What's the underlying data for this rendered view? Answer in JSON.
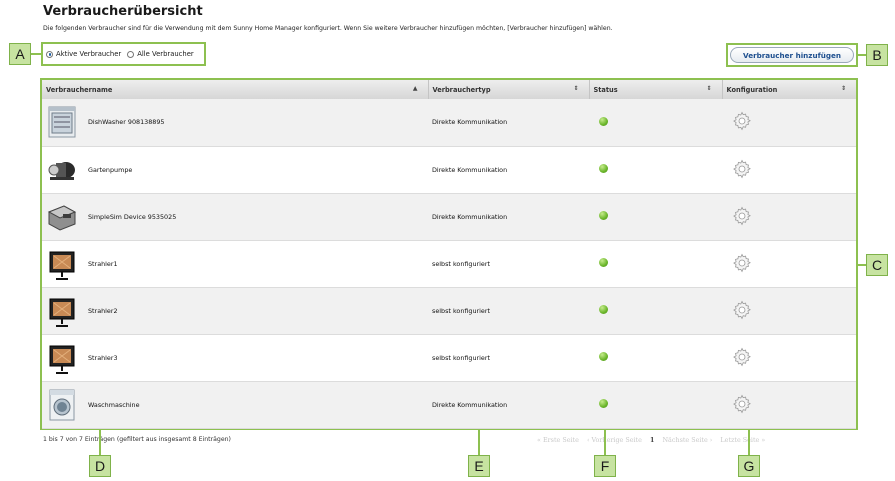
{
  "page": {
    "title": "Verbraucherübersicht",
    "description": "Die folgenden Verbraucher sind für die Verwendung mit dem Sunny Home Manager konfiguriert. Wenn Sie weitere Verbraucher hinzufügen möchten, [Verbraucher hinzufügen] wählen."
  },
  "filter": {
    "active_label": "Aktive Verbraucher",
    "all_label": "Alle Verbraucher",
    "selected": "active"
  },
  "add_button": {
    "label": "Verbraucher hinzufügen"
  },
  "table": {
    "columns": [
      "Verbrauchername",
      "Verbrauchertyp",
      "Status",
      "Konfiguration"
    ],
    "sort_icon": "▲",
    "sortable_icon": "⇕",
    "rows": [
      {
        "name": "DishWasher 908138895",
        "type": "Direkte Kommunikation",
        "image": "dishwasher-icon",
        "status": "active"
      },
      {
        "name": "Gartenpumpe",
        "type": "Direkte Kommunikation",
        "image": "pump-icon",
        "status": "active"
      },
      {
        "name": "SimpleSim Device 9535025",
        "type": "Direkte Kommunikation",
        "image": "device-icon",
        "status": "active"
      },
      {
        "name": "Strahler1",
        "type": "selbst konfiguriert",
        "image": "floodlight-icon",
        "status": "active"
      },
      {
        "name": "Strahler2",
        "type": "selbst konfiguriert",
        "image": "floodlight-icon",
        "status": "active"
      },
      {
        "name": "Strahler3",
        "type": "selbst konfiguriert",
        "image": "floodlight-icon",
        "status": "active"
      },
      {
        "name": "Waschmaschine",
        "type": "Direkte Kommunikation",
        "image": "washing-machine-icon",
        "status": "active"
      }
    ]
  },
  "footer": {
    "info": "1 bis 7 von 7 Einträgen (gefiltert aus insgesamt 8 Einträgen)",
    "first": "« Erste Seite",
    "prev": "‹ Vorherige Seite",
    "current": "1",
    "next": "Nächste Seite ›",
    "last": "Letzte Seite »"
  },
  "callouts": {
    "a": "A",
    "b": "B",
    "c": "C",
    "d": "D",
    "e": "E",
    "f": "F",
    "g": "G"
  },
  "colors": {
    "callout_fill": "#c7e3a1",
    "callout_line": "#8dc050",
    "status_green": "#6ab52a",
    "link_blue": "#1e4f8f"
  }
}
